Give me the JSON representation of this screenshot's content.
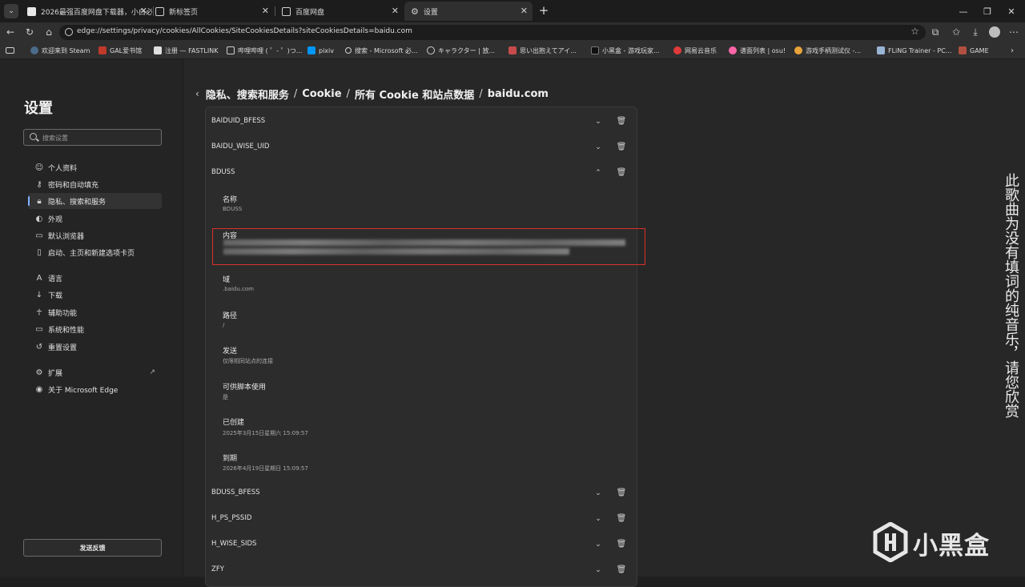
{
  "tabs": [
    {
      "label": "2026最强百度网盘下载器，小白必...",
      "active": false
    },
    {
      "label": "新标签页",
      "active": false
    },
    {
      "label": "百度网盘",
      "active": false
    },
    {
      "label": "设置",
      "active": true
    }
  ],
  "address": {
    "url": "edge://settings/privacy/cookies/AllCookies/SiteCookiesDetails?siteCookiesDetails=baidu.com"
  },
  "favorites": [
    {
      "label": "欢迎来到 Steam"
    },
    {
      "label": "GAL爱书馆"
    },
    {
      "label": "注册 — FASTLINK"
    },
    {
      "label": "哔哩哔哩 ( ゜- ゜)つ..."
    },
    {
      "label": "pixiv"
    },
    {
      "label": "搜索 - Microsoft 必..."
    },
    {
      "label": "キャラクター | 放..."
    },
    {
      "label": "思い出抱えてアイ..."
    },
    {
      "label": "小黑盒 - 游戏玩家..."
    },
    {
      "label": "网易云音乐"
    },
    {
      "label": "谱面列表 | osu!"
    },
    {
      "label": "游戏手柄测试仪 -..."
    },
    {
      "label": "FLiNG Trainer - PC..."
    },
    {
      "label": "GAME"
    }
  ],
  "sidebar": {
    "title": "设置",
    "search_placeholder": "搜索设置",
    "items": [
      {
        "label": "个人资料",
        "icon": "person-icon"
      },
      {
        "label": "密码和自动填充",
        "icon": "key-icon"
      },
      {
        "label": "隐私、搜索和服务",
        "icon": "lock-icon",
        "selected": true
      },
      {
        "label": "外观",
        "icon": "appearance-icon"
      },
      {
        "label": "默认浏览器",
        "icon": "browser-icon"
      },
      {
        "label": "启动、主页和新建选项卡页",
        "icon": "home-icon"
      },
      {
        "label": "语言",
        "icon": "language-icon"
      },
      {
        "label": "下载",
        "icon": "download-icon"
      },
      {
        "label": "辅助功能",
        "icon": "accessibility-icon"
      },
      {
        "label": "系统和性能",
        "icon": "laptop-icon"
      },
      {
        "label": "重置设置",
        "icon": "reset-icon"
      },
      {
        "label": "扩展",
        "icon": "extension-icon"
      },
      {
        "label": "关于 Microsoft Edge",
        "icon": "edge-icon"
      }
    ],
    "feedback_label": "发送反馈"
  },
  "breadcrumb": [
    "隐私、搜索和服务",
    "Cookie",
    "所有 Cookie 和站点数据",
    "baidu.com"
  ],
  "cookies_top": [
    {
      "name": "BAIDUID_BFESS"
    },
    {
      "name": "BAIDU_WISE_UID"
    },
    {
      "name": "BDUSS",
      "expanded": true
    }
  ],
  "bduss_details": [
    {
      "label": "名称",
      "value": "BDUSS"
    },
    {
      "label": "内容",
      "value": ""
    },
    {
      "label": "域",
      "value": ".baidu.com"
    },
    {
      "label": "路径",
      "value": "/"
    },
    {
      "label": "发送",
      "value": "仅限相同站点的连接"
    },
    {
      "label": "可供脚本使用",
      "value": "是"
    },
    {
      "label": "已创建",
      "value": "2025年3月15日星期六 15:09:57"
    },
    {
      "label": "到期",
      "value": "2026年4月19日星期日 15:09:57"
    }
  ],
  "cookies_bottom": [
    {
      "name": "BDUSS_BFESS"
    },
    {
      "name": "H_PS_PSSID"
    },
    {
      "name": "H_WISE_SIDS"
    },
    {
      "name": "ZFY"
    }
  ],
  "side_text": "此歌曲为没有填词的纯音乐，请您欣赏",
  "watermark": "小黑盒",
  "colors": {
    "highlight": "#d9302b",
    "accent": "#7fb3ff"
  }
}
